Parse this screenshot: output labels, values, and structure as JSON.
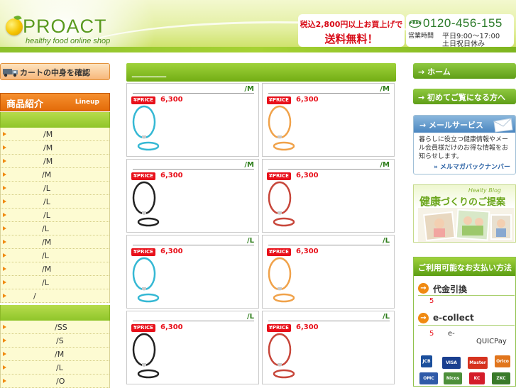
{
  "header": {
    "logo_text": "PROACT",
    "logo_sub": "healthy food online shop",
    "promo_line1": "税込2,800円以上お買上げで",
    "promo_line2": "送料無料！",
    "free_dial_mark": "FREE",
    "phone": "0120-456-155",
    "hours_label": "営業時間",
    "hours_line1": "平日9:00～17:00",
    "hours_line2": "土日祝日休み"
  },
  "left": {
    "cart_label": "カートの中身を確認",
    "lineup_ja": "商品紹介",
    "lineup_en": "Lineup",
    "menu_group1": [
      "/M",
      "/M",
      "/M",
      "/M",
      "/L",
      "/L",
      "/L",
      "/L",
      "/M",
      "/L",
      "/M",
      "/L",
      "/"
    ],
    "menu_group2": [
      "/SS",
      "/S",
      "/M",
      "/L",
      "/O"
    ]
  },
  "center": {
    "title": "＿＿＿＿",
    "price_badge": "¥PRICE",
    "products": [
      {
        "name": "/M",
        "price": "6,300",
        "color": "#35b8d4"
      },
      {
        "name": "/M",
        "price": "6,300",
        "color": "#f0a24a"
      },
      {
        "name": "/M",
        "price": "6,300",
        "color": "#222222"
      },
      {
        "name": "/M",
        "price": "6,300",
        "color": "#c7463a"
      },
      {
        "name": "/L",
        "price": "6,300",
        "color": "#35b8d4"
      },
      {
        "name": "/L",
        "price": "6,300",
        "color": "#f0a24a"
      },
      {
        "name": "/L",
        "price": "6,300",
        "color": "#222222"
      },
      {
        "name": "/L",
        "price": "6,300",
        "color": "#c7463a"
      }
    ]
  },
  "right": {
    "home": "→ ホーム",
    "first_time": "→ 初めてご覧になる方へ",
    "mail_title": "→ メールサービス",
    "mail_desc": "暮らしに役立つ健康情報やメール会員様だけのお得な情報をお知らせします。",
    "mail_link": "» メルマガバックナンバー",
    "blog_tag": "Healty Blog",
    "blog_title_big": "健康",
    "blog_title_rest": "づくりのご提案",
    "pay_title": "ご利用可能なお支払い方法",
    "pay_cod": "代金引換",
    "pay_ecollect": "e-collect",
    "pay_arrow": "→",
    "pay_note1": "5",
    "pay_note2": "5",
    "pay_note3": "e-",
    "pay_note4": "QUICPay",
    "cards": [
      "JCB",
      "VISA",
      "Master",
      "Orico",
      "OMC",
      "Nicos",
      "KC",
      "ZKC"
    ]
  }
}
